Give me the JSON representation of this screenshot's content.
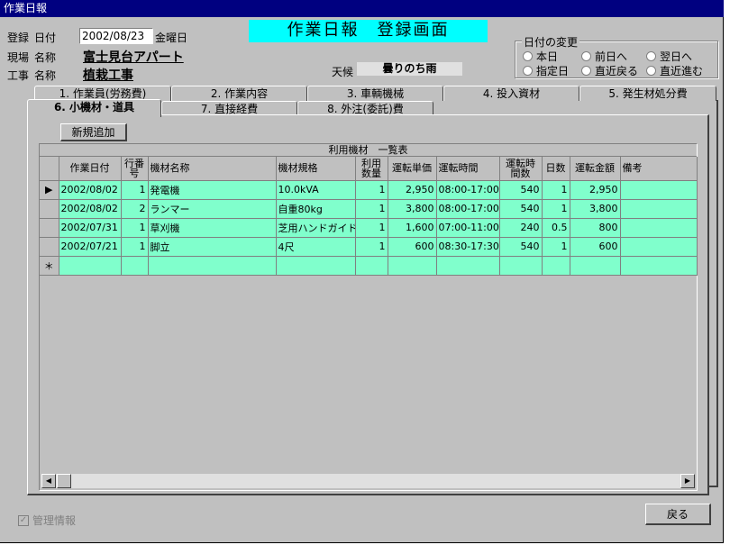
{
  "window": {
    "title": "作業日報"
  },
  "header": {
    "register_label": "登録",
    "date_label": "日付",
    "date_value": "2002/08/23",
    "weekday": "金曜日",
    "site_label": "現場",
    "site_name_label": "名称",
    "site_name": "富士見台アパート",
    "work_label": "工事",
    "work_name_label": "名称",
    "work_name": "植栽工事",
    "banner": "作業日報　登録画面",
    "weather_label": "天候",
    "weather_value": "曇りのち雨"
  },
  "date_change": {
    "title": "日付の変更",
    "options": [
      "本日",
      "前日へ",
      "翌日へ",
      "指定日",
      "直近戻る",
      "直近進む"
    ]
  },
  "tabs_row1": [
    "1. 作業員(労務費)",
    "2. 作業内容",
    "3. 車輌機械",
    "4. 投入資材",
    "5. 発生材処分費"
  ],
  "tabs_row2": [
    "6. 小機材・道具",
    "7. 直接経費",
    "8. 外注(委託)費"
  ],
  "panel": {
    "new_button": "新規追加",
    "grid_caption": "利用機材　一覧表",
    "columns": [
      "作業日付",
      "行番号",
      "機材名称",
      "機材規格",
      "利用数量",
      "運転単価",
      "運転時間",
      "運転時間数",
      "日数",
      "運転金額",
      "備考"
    ],
    "rows": [
      [
        "2002/08/02",
        "1",
        "発電機",
        "10.0kVA",
        "1",
        "2,950",
        "08:00-17:00",
        "540",
        "1",
        "2,950",
        ""
      ],
      [
        "2002/08/02",
        "2",
        "ランマー",
        "自重80kg",
        "1",
        "3,800",
        "08:00-17:00",
        "540",
        "1",
        "3,800",
        ""
      ],
      [
        "2002/07/31",
        "1",
        "草刈機",
        "芝用ハンドガイド:",
        "1",
        "1,600",
        "07:00-11:00",
        "240",
        "0.5",
        "800",
        ""
      ],
      [
        "2002/07/21",
        "1",
        "脚立",
        "4尺",
        "1",
        "600",
        "08:30-17:30",
        "540",
        "1",
        "600",
        ""
      ]
    ],
    "new_row_marker": "＊",
    "current_row_marker": "▶"
  },
  "footer": {
    "admin_info": "管理情報",
    "back_button": "戻る"
  }
}
